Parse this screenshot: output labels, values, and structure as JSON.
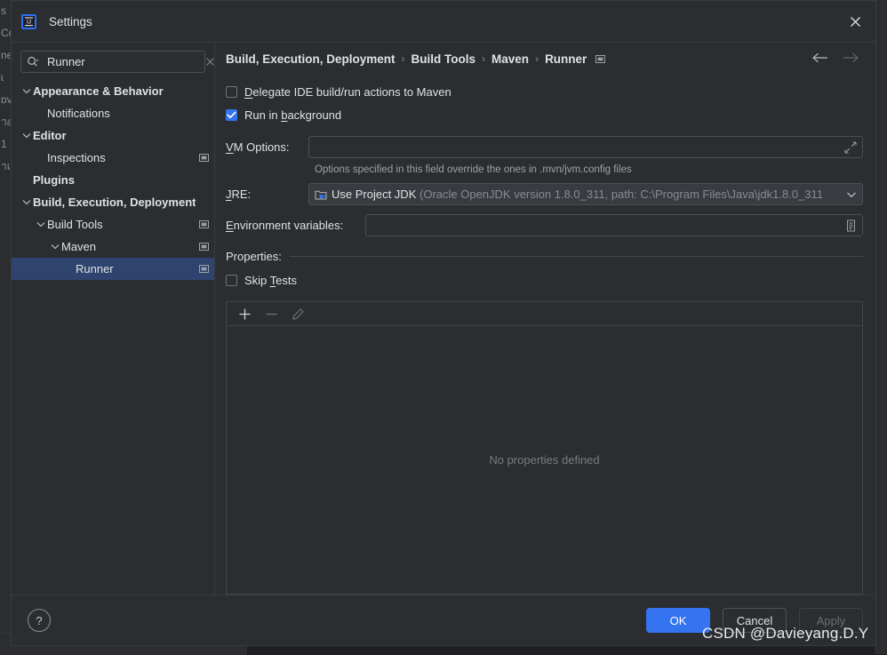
{
  "window": {
    "title": "Settings",
    "logo_text": "IJ",
    "close_icon": "close-icon"
  },
  "sidebar": {
    "search": {
      "value": "Runner",
      "placeholder": "",
      "search_icon": "search-icon",
      "clear_icon": "clear-icon"
    },
    "items": [
      {
        "label": "Appearance & Behavior",
        "indent": 0,
        "arrow": "expanded",
        "bold": true,
        "badge": false,
        "selected": false
      },
      {
        "label": "Notifications",
        "indent": 1,
        "arrow": "none",
        "bold": false,
        "badge": false,
        "selected": false
      },
      {
        "label": "Editor",
        "indent": 0,
        "arrow": "expanded",
        "bold": true,
        "badge": false,
        "selected": false
      },
      {
        "label": "Inspections",
        "indent": 1,
        "arrow": "none",
        "bold": false,
        "badge": true,
        "selected": false
      },
      {
        "label": "Plugins",
        "indent": 0,
        "arrow": "none",
        "bold": true,
        "badge": false,
        "selected": false
      },
      {
        "label": "Build, Execution, Deployment",
        "indent": 0,
        "arrow": "expanded",
        "bold": true,
        "badge": false,
        "selected": false
      },
      {
        "label": "Build Tools",
        "indent": 1,
        "arrow": "expanded",
        "bold": false,
        "badge": true,
        "selected": false
      },
      {
        "label": "Maven",
        "indent": 2,
        "arrow": "expanded",
        "bold": false,
        "badge": true,
        "selected": false
      },
      {
        "label": "Runner",
        "indent": 3,
        "arrow": "none",
        "bold": false,
        "badge": true,
        "selected": true
      }
    ]
  },
  "breadcrumb": {
    "items": [
      "Build, Execution, Deployment",
      "Build Tools",
      "Maven",
      "Runner"
    ],
    "separator": "›",
    "badge_icon": "project-scope-icon",
    "back_icon": "arrow-left-icon",
    "forward_icon": "arrow-right-icon"
  },
  "main": {
    "delegate": {
      "label_before": "D",
      "label_mnemonic": "",
      "label": "Delegate IDE build/run actions to Maven",
      "checked": false
    },
    "run_background": {
      "label": "Run in background",
      "checked": true
    },
    "vm_options": {
      "label": "VM Options:",
      "value": "",
      "placeholder": "",
      "expand_icon": "expand-icon",
      "hint": "Options specified in this field override the ones in .mvn/jvm.config files"
    },
    "jre": {
      "label": "JRE:",
      "icon": "jdk-icon",
      "value_primary": "Use Project JDK",
      "value_secondary": "(Oracle OpenJDK version 1.8.0_311, path: C:\\Program Files\\Java\\jdk1.8.0_311",
      "chevron_icon": "chevron-down-icon"
    },
    "environment_variables": {
      "label": "Environment variables:",
      "value": "",
      "placeholder": "",
      "browse_icon": "list-icon"
    },
    "properties": {
      "section_label": "Properties:",
      "skip_tests": {
        "label": "Skip Tests",
        "checked": false
      },
      "toolbar": {
        "add_icon": "plus-icon",
        "remove_icon": "minus-icon",
        "edit_icon": "pencil-icon",
        "add_enabled": true,
        "remove_enabled": false,
        "edit_enabled": false
      },
      "empty_text": "No properties defined"
    }
  },
  "footer": {
    "help_icon": "question-mark-icon",
    "ok_label": "OK",
    "cancel_label": "Cancel",
    "apply_label": "Apply",
    "apply_enabled": false
  },
  "watermark": {
    "text": "CSDN @Davieyang.D.Y"
  },
  "colors": {
    "accent": "#3574f0",
    "selection": "#2e436e",
    "panel_bg": "#2b2d30",
    "app_bg": "#1e1f22",
    "border": "#43464b",
    "text": "#dfe1e5",
    "text_dim": "#878b91"
  },
  "background_strip": {
    "glyphs": [
      "s",
      "Cc",
      "",
      "",
      "",
      "",
      "",
      "",
      "",
      "",
      "",
      "",
      "",
      "",
      "",
      "",
      "",
      "",
      "ne",
      "ɩ",
      "",
      "",
      "",
      "ɒv",
      "าa",
      "1",
      "าเ"
    ]
  }
}
